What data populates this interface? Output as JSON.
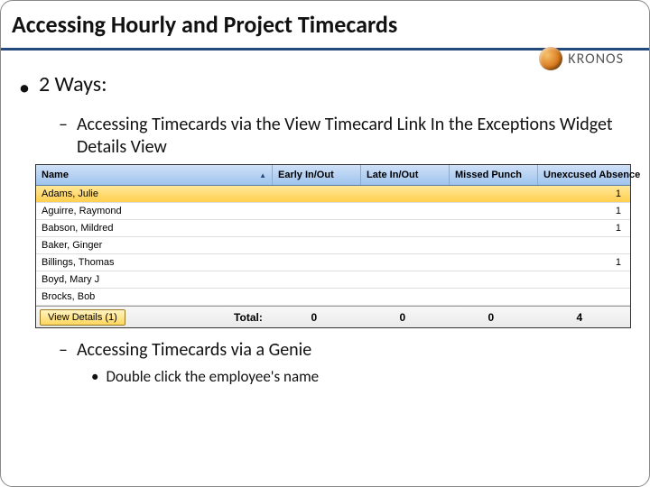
{
  "title": "Accessing Hourly and Project Timecards",
  "logo_text": "KRONOS",
  "bullets": {
    "ways_heading": "2 Ways:",
    "way1": "Accessing Timecards via the View Timecard Link In the Exceptions Widget Details View",
    "way2": "Accessing Timecards via a Genie",
    "way2_sub": "Double click the employee's name"
  },
  "table": {
    "headers": {
      "name": "Name",
      "early": "Early In/Out",
      "late": "Late In/Out",
      "missed": "Missed Punch",
      "unexcused": "Unexcused Absence"
    },
    "rows": [
      {
        "name": "Adams, Julie",
        "early": "",
        "late": "",
        "missed": "",
        "unexcused": "1",
        "selected": true
      },
      {
        "name": "Aguirre, Raymond",
        "early": "",
        "late": "",
        "missed": "",
        "unexcused": "1",
        "selected": false
      },
      {
        "name": "Babson, Mildred",
        "early": "",
        "late": "",
        "missed": "",
        "unexcused": "1",
        "selected": false
      },
      {
        "name": "Baker, Ginger",
        "early": "",
        "late": "",
        "missed": "",
        "unexcused": "",
        "selected": false
      },
      {
        "name": "Billings, Thomas",
        "early": "",
        "late": "",
        "missed": "",
        "unexcused": "1",
        "selected": false
      },
      {
        "name": "Boyd, Mary J",
        "early": "",
        "late": "",
        "missed": "",
        "unexcused": "",
        "selected": false
      },
      {
        "name": "Brocks, Bob",
        "early": "",
        "late": "",
        "missed": "",
        "unexcused": "",
        "selected": false
      }
    ],
    "footer": {
      "button_label": "View Details (1)",
      "total_label": "Total:",
      "totals": {
        "early": "0",
        "late": "0",
        "missed": "0",
        "unexcused": "4"
      }
    }
  }
}
